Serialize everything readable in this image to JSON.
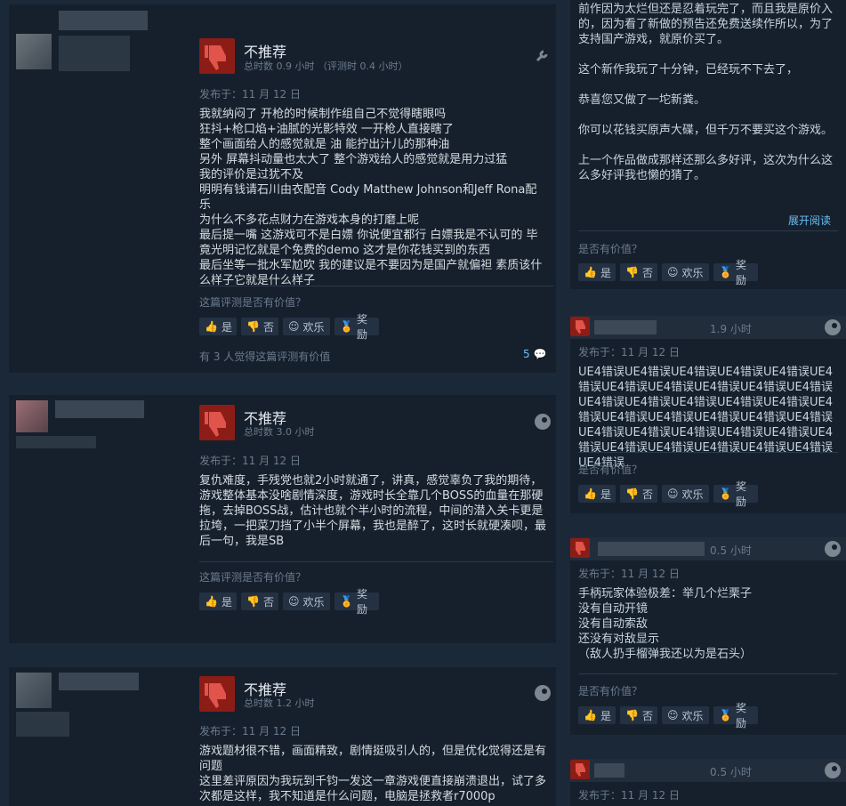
{
  "reviews": [
    {
      "verdict": "不推荐",
      "hours": "总时数 0.9 小时 （评测时 0.4 小时）",
      "posted": "发布于：11 月 12 日",
      "text": "我就纳闷了 开枪的时候制作组自己不觉得瞎眼吗\n狂抖+枪口焰+油腻的光影特效 一开枪人直接瞎了\n整个画面给人的感觉就是 油 能拧出汁儿的那种油\n另外 屏幕抖动量也太大了 整个游戏给人的感觉就是用力过猛\n我的评价是过犹不及\n明明有钱请石川由衣配音 Cody Matthew Johnson和Jeff Rona配乐\n为什么不多花点财力在游戏本身的打磨上呢\n最后提一嘴 这游戏可不是白嫖 你说便宜都行 白嫖我是不认可的 毕竟光明记忆就是个免费的demo 这才是你花钱买到的东西\n最后坐等一批水军尬吹 我的建议是不要因为是国产就偏袒 素质该什么样子它就是什么样子",
      "helpful_q": "这篇评测是否有价值？",
      "helpful_count": "有 3 人觉得这篇评测有价值",
      "comments": "5"
    },
    {
      "verdict": "不推荐",
      "hours": "总时数 3.0 小时",
      "posted": "发布于：11 月 12 日",
      "text": "复仇难度，手残党也就2小时就通了，讲真，感觉辜负了我的期待，游戏整体基本没啥剧情深度，游戏时长全靠几个BOSS的血量在那硬拖，去掉BOSS战，估计也就个半小时的流程，中间的潜入关卡更是拉垮，一把菜刀挡了小半个屏幕，我也是醉了，这时长就硬凑呗，最后一句，我是SB",
      "helpful_q": "这篇评测是否有价值？"
    },
    {
      "verdict": "不推荐",
      "hours": "总时数 1.2 小时",
      "posted": "发布于：11 月 12 日",
      "text": "游戏题材很不错，画面精致，剧情挺吸引人的，但是优化觉得还是有问题\n这里差评原因为我玩到千钧一发这一章游戏便直接崩溃退出，试了多次都是这样，我不知道是什么问题，电脑是拯救者r7000p"
    }
  ],
  "buttons": {
    "yes": "是",
    "no": "否",
    "funny": "欢乐",
    "award": "奖励"
  },
  "right_top": {
    "text": "前作因为太烂但还是忍着玩完了，而且我是原价入的，因为看了新做的预告还免费送续作所以，为了支持国产游戏，就原价买了。\n\n这个新作我玩了十分钟，已经玩不下去了，\n\n恭喜您又做了一坨新粪。\n\n你可以花钱买原声大碟，但千万不要买这个游戏。\n\n上一个作品做成那样还那么多好评，这次为什么这么多好评我也懒的猜了。",
    "expand": "展开阅读",
    "helpful_q": "是否有价值？"
  },
  "right_reviews": [
    {
      "hours": "1.9 小时",
      "posted": "发布于：11 月 12 日",
      "text": "UE4错误UE4错误UE4错误UE4错误UE4错误UE4错误UE4错误UE4错误UE4错误UE4错误UE4错误UE4错误UE4错误UE4错误UE4错误UE4错误UE4错误UE4错误UE4错误UE4错误UE4错误UE4错误UE4错误UE4错误UE4错误UE4错误UE4错误UE4错误UE4错误UE4错误UE4错误UE4错误UE4错误UE4错误",
      "helpful_q": "是否有价值？"
    },
    {
      "hours": "0.5 小时",
      "posted": "发布于：11 月 12 日",
      "text": "手柄玩家体验极差：举几个烂栗子\n没有自动开镜\n没有自动索敌\n还没有对敌显示\n（敌人扔手榴弹我还以为是石头）",
      "helpful_q": "是否有价值？"
    },
    {
      "hours": "0.5 小时",
      "posted": "发布于：11 月 12 日"
    }
  ]
}
